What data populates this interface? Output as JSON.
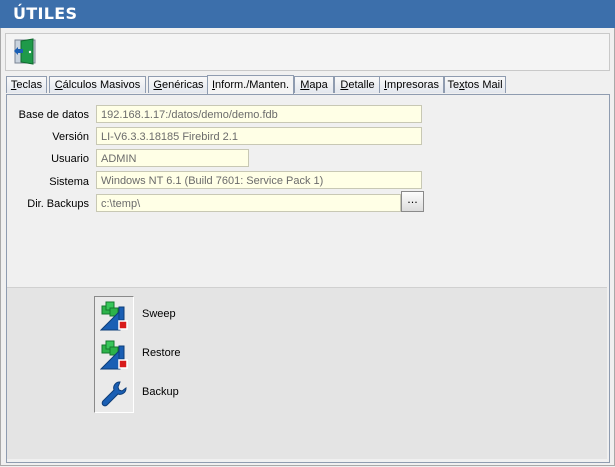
{
  "window": {
    "title": "ÚTILES"
  },
  "toolbar": {
    "exit_icon": "exit-door-icon"
  },
  "tabs": [
    {
      "label": "Teclas",
      "accel": "T",
      "active": false
    },
    {
      "label": "Cálculos Masivos",
      "accel": "C",
      "active": false
    },
    {
      "label": "Genéricas",
      "accel": "G",
      "active": false
    },
    {
      "label": "Inform./Manten.",
      "accel": "I",
      "active": true
    },
    {
      "label": "Mapa",
      "accel": "M",
      "active": false
    },
    {
      "label": "Detalle",
      "accel": "D",
      "active": false
    },
    {
      "label": "Impresoras",
      "accel": "I",
      "active": false
    },
    {
      "label": "Textos Mail",
      "accel": "x",
      "active": false
    }
  ],
  "info": {
    "base_label": "Base de datos",
    "base_value": "192.168.1.17:/datos/demo/demo.fdb",
    "version_label": "Versión",
    "version_value": "LI-V6.3.3.18185 Firebird 2.1",
    "usuario_label": "Usuario",
    "usuario_value": "ADMIN",
    "sistema_label": "Sistema",
    "sistema_value": "Windows NT 6.1 (Build 7601: Service Pack 1)",
    "backups_label": "Dir. Backups",
    "backups_value": "c:\\temp\\",
    "browse_label": "..."
  },
  "actions": {
    "sweep": {
      "label": "Sweep",
      "icon": "database-sweep-icon"
    },
    "restore": {
      "label": "Restore",
      "icon": "database-restore-icon"
    },
    "backup": {
      "label": "Backup",
      "icon": "wrench-icon"
    }
  },
  "colors": {
    "title_bar": "#3c6fab",
    "field_background": "#ffffe6",
    "icon_blue": "#1a5fb4",
    "icon_green": "#2db34a",
    "icon_red": "#d81b1b"
  }
}
